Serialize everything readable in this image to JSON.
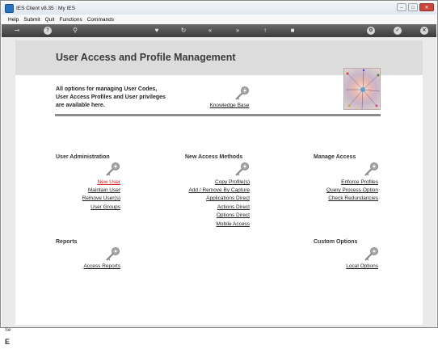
{
  "window": {
    "title": "IES Client v8.35 : My IES"
  },
  "menu": [
    "Help",
    "Submit",
    "Quit",
    "Functions",
    "Commands"
  ],
  "page": {
    "title": "User Access and Profile Management",
    "intro_lines": [
      "All options for managing User Codes,",
      "User Access Profiles and User privileges",
      "are available here."
    ],
    "knowledge_base": "Knowledge Base"
  },
  "sections": {
    "user_admin": {
      "title": "User Administration",
      "links": [
        "New User",
        "Maintain User",
        "Remove User(s)",
        "User Groups"
      ]
    },
    "new_access": {
      "title": "New Access Methods",
      "links": [
        "Copy Profile(s)",
        "Add / Remove By Capture",
        "Applications Direct",
        "Actions Direct",
        "Options Direct",
        "Mobile Access"
      ]
    },
    "manage_access": {
      "title": "Manage Access",
      "links": [
        "Enforce Profiles",
        "Query Process Option",
        "Check Redundancies"
      ]
    },
    "reports": {
      "title": "Reports",
      "links": [
        "Access Reports"
      ]
    },
    "custom_options": {
      "title": "Custom Options",
      "links": [
        "Local Options"
      ]
    }
  },
  "side_strip": {
    "top": "Se",
    "bottom": "E"
  },
  "colors": {
    "toolbar": "#4a4a4a",
    "header_band": "#dcdcdc",
    "active_link": "#d11a1a",
    "key_icon": "#9a9a9a"
  }
}
